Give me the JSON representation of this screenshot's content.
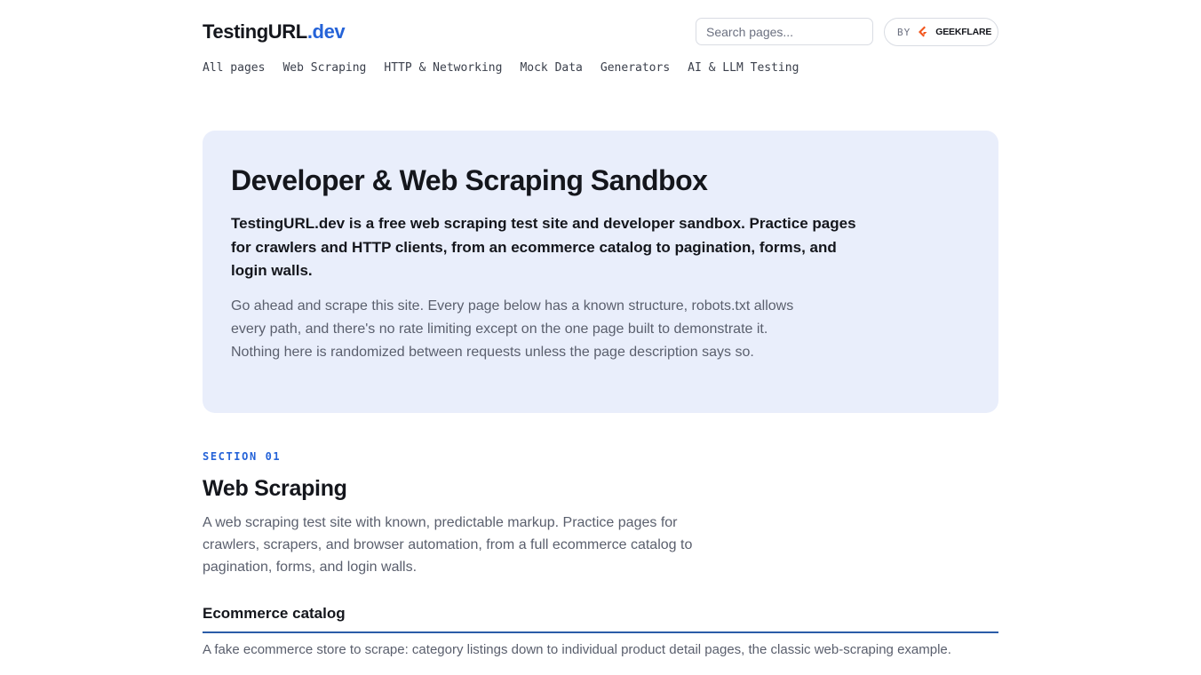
{
  "header": {
    "logo_main": "TestingURL",
    "logo_accent": ".dev",
    "search_placeholder": "Search pages...",
    "badge_by": "BY",
    "badge_brand": "GEEKFLARE",
    "badge_icon": "geekflare-logo-icon"
  },
  "nav": {
    "items": [
      "All pages",
      "Web Scraping",
      "HTTP & Networking",
      "Mock Data",
      "Generators",
      "AI & LLM Testing"
    ]
  },
  "hero": {
    "title": "Developer & Web Scraping Sandbox",
    "lead": "TestingURL.dev is a free web scraping test site and developer sandbox. Practice pages for crawlers and HTTP clients, from an ecommerce catalog to pagination, forms, and login walls.",
    "sub": "Go ahead and scrape this site. Every page below has a known structure, robots.txt allows every path, and there's no rate limiting except on the one page built to demonstrate it. Nothing here is randomized between requests unless the page description says so."
  },
  "section": {
    "eyebrow": "SECTION 01",
    "title": "Web Scraping",
    "description": "A web scraping test site with known, predictable markup. Practice pages for crawlers, scrapers, and browser automation, from a full ecommerce catalog to pagination, forms, and login walls.",
    "category_title": "Ecommerce catalog",
    "category_description": "A fake ecommerce store to scrape: category listings down to individual product detail pages, the classic web-scraping example."
  },
  "colors": {
    "accent": "#2563d8",
    "hero_bg": "#e9eefb",
    "brand_orange": "#f2561d"
  }
}
